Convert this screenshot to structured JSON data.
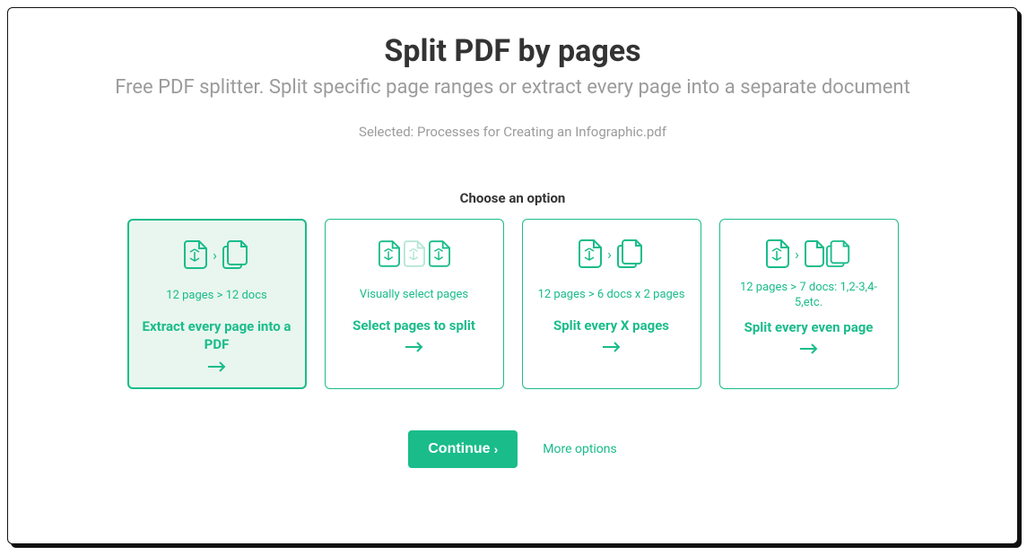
{
  "header": {
    "title": "Split PDF by pages",
    "subtitle": "Free PDF splitter. Split specific page ranges or extract every page into a separate document",
    "selected_file": "Selected: Processes for Creating an Infographic.pdf",
    "choose_label": "Choose an option"
  },
  "options": [
    {
      "subtext": "12 pages > 12 docs",
      "title": "Extract every page into a PDF",
      "selected": true
    },
    {
      "subtext": "Visually select pages",
      "title": "Select pages to split",
      "selected": false
    },
    {
      "subtext": "12 pages > 6 docs x 2 pages",
      "title": "Split every X pages",
      "selected": false
    },
    {
      "subtext": "12 pages > 7 docs: 1,2-3,4-5,etc.",
      "title": "Split every even page",
      "selected": false
    }
  ],
  "actions": {
    "continue_label": "Continue",
    "more_options_label": "More options"
  },
  "colors": {
    "accent": "#1abc8a"
  }
}
